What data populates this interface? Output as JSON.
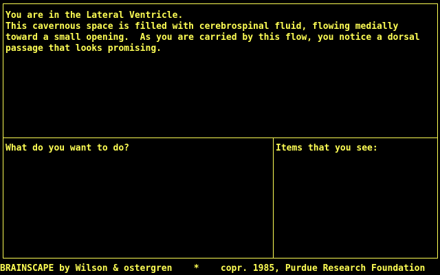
{
  "description": {
    "lines": [
      "You are in the Lateral Ventricle.",
      "This cavernous space is filled with cerebrospinal fluid, flowing medially",
      "toward a small opening.  As you are carried by this flow, you notice a dorsal",
      "passage that looks promising."
    ]
  },
  "prompt": {
    "label": "What do you want to do?"
  },
  "items": {
    "label": "Items that you see:"
  },
  "footer": {
    "text": "BRAINSCAPE by Wilson & ostergren    *    copr. 1985, Purdue Research Foundation"
  },
  "colors": {
    "text": "#ffff55",
    "background": "#000000",
    "border": "#ffff55"
  }
}
